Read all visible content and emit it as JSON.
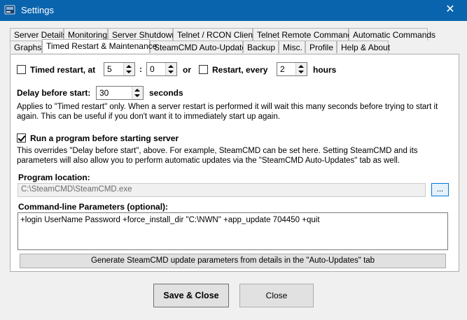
{
  "window": {
    "title": "Settings",
    "close_glyph": "✕"
  },
  "tabs": {
    "row1": [
      "Server Details",
      "Monitoring",
      "Server Shutdown",
      "Telnet / RCON Client",
      "Telnet Remote Commands",
      "Automatic Commands"
    ],
    "row2": [
      "Graphs",
      "Timed Restart & Maintenance",
      "SteamCMD Auto-Updates",
      "Backup",
      "Misc.",
      "Profile",
      "Help & About"
    ],
    "active": "Timed Restart & Maintenance"
  },
  "timed_restart": {
    "at_label": "Timed restart, at",
    "hour": "5",
    "sep": ":",
    "minute": "0",
    "or_label": "or",
    "every_label": "Restart, every",
    "every_value": "2",
    "hours_label": "hours",
    "at_checked": false,
    "every_checked": false
  },
  "delay": {
    "label": "Delay before start:",
    "value": "30",
    "unit": "seconds",
    "description": "Applies to \"Timed restart\" only. When a server restart is performed it will wait this many seconds before trying to start it again. This can be useful if you don't want it to immediately start up again."
  },
  "run_program": {
    "label": "Run a program before starting server",
    "checked": true,
    "description": "This overrides \"Delay before start\", above. For example, SteamCMD can be set here. Setting SteamCMD and its parameters will also allow you to perform automatic updates via the \"SteamCMD Auto-Updates\" tab as well."
  },
  "program_location": {
    "label": "Program location:",
    "value": "C:\\SteamCMD\\SteamCMD.exe",
    "browse_label": "..."
  },
  "cmdline": {
    "label": "Command-line Parameters (optional):",
    "value": "+login UserName Password +force_install_dir \"C:\\NWN\" +app_update 704450 +quit"
  },
  "generate_button": "Generate SteamCMD update parameters from details in the \"Auto-Updates\" tab",
  "footer": {
    "save_close": "Save & Close",
    "close": "Close"
  },
  "colors": {
    "titlebar": "#0a64ad",
    "accent": "#0078d7"
  }
}
